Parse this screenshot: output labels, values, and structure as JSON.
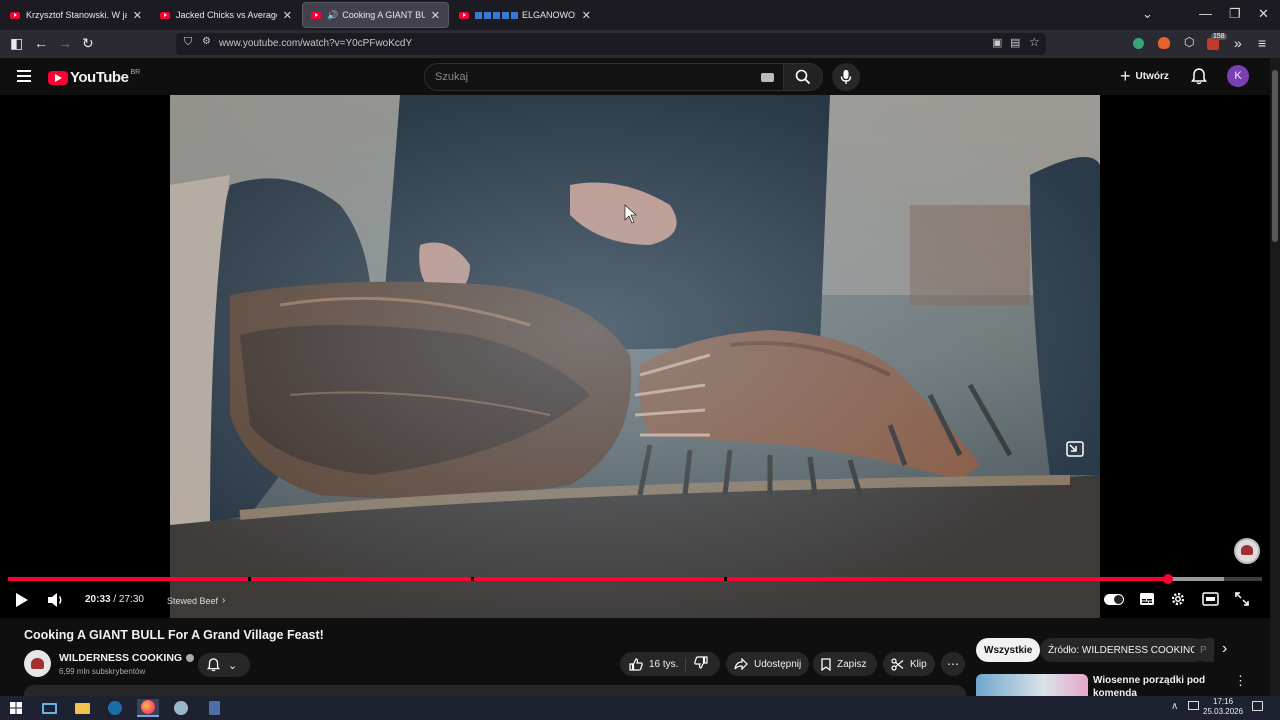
{
  "browser": {
    "tabs": [
      {
        "title": "Krzysztof Stanowski. W jakiej sp"
      },
      {
        "title": "Jacked Chicks vs Average Joes |"
      },
      {
        "title": "Cooking A GIANT BULL For"
      },
      {
        "title": "ELGANOWO: D"
      }
    ],
    "url": "www.youtube.com/watch?v=Y0cPFwoKcdY",
    "extension_badge": "158"
  },
  "youtube": {
    "logo_text": "YouTube",
    "country_code": "BR",
    "search_placeholder": "Szukaj",
    "create_label": "Utwórz",
    "avatar_letter": "K"
  },
  "player": {
    "time_current": "20:33",
    "time_separator": " / ",
    "time_total": "27:30",
    "chapter": "Stewed Beef",
    "progress": 0.925,
    "buffered": 0.97,
    "colors": {
      "progress": "#ff0033",
      "buffer": "#9a9a9a"
    }
  },
  "video_info": {
    "title": "Cooking A GIANT BULL For A Grand Village Feast!",
    "channel_name": "WILDERNESS COOKING",
    "subscribers": "6,99 mln subskrybentów",
    "likes": "16 tys.",
    "share_label": "Udostępnij",
    "save_label": "Zapisz",
    "clip_label": "Klip"
  },
  "sidebar": {
    "chips": [
      "Wszystkie",
      "Źródło: WILDERNESS COOKING",
      "P"
    ],
    "first_video_title": "Wiosenne porządki pod komendą"
  },
  "taskbar": {
    "time": "17:16",
    "date": "25.03.2026"
  }
}
